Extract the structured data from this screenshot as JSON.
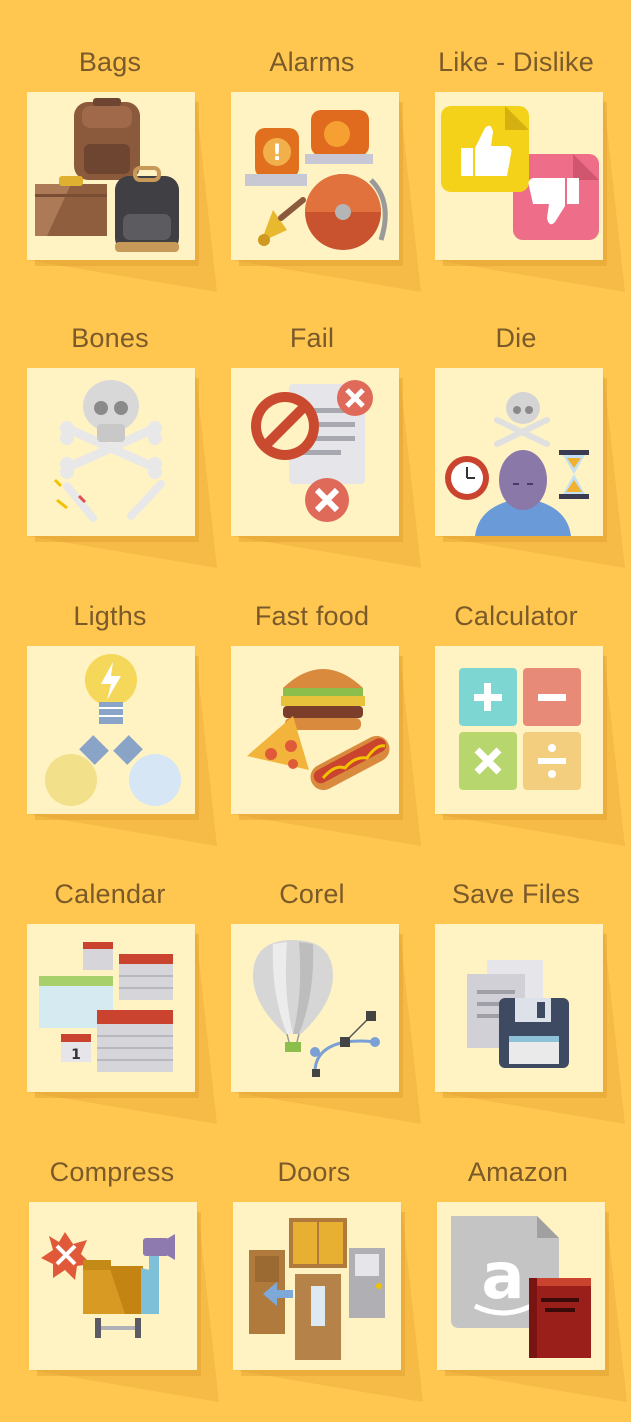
{
  "icons": [
    {
      "title": "Bags",
      "icon": "bags-icon"
    },
    {
      "title": "Alarms",
      "icon": "alarms-icon"
    },
    {
      "title": "Like - Dislike",
      "icon": "like-dislike-icon"
    },
    {
      "title": "Bones",
      "icon": "bones-icon"
    },
    {
      "title": "Fail",
      "icon": "fail-icon"
    },
    {
      "title": "Die",
      "icon": "die-icon"
    },
    {
      "title": "Ligths",
      "icon": "lights-icon"
    },
    {
      "title": "Fast food",
      "icon": "fast-food-icon"
    },
    {
      "title": "Calculator",
      "icon": "calculator-icon"
    },
    {
      "title": "Calendar",
      "icon": "calendar-icon"
    },
    {
      "title": "Corel",
      "icon": "corel-icon"
    },
    {
      "title": "Save Files",
      "icon": "save-files-icon"
    },
    {
      "title": "Compress",
      "icon": "compress-icon"
    },
    {
      "title": "Doors",
      "icon": "doors-icon"
    },
    {
      "title": "Amazon",
      "icon": "amazon-icon"
    }
  ],
  "colors": {
    "background": "#FFC750",
    "card": "#FFF3C4",
    "label": "#7a5a2a"
  }
}
